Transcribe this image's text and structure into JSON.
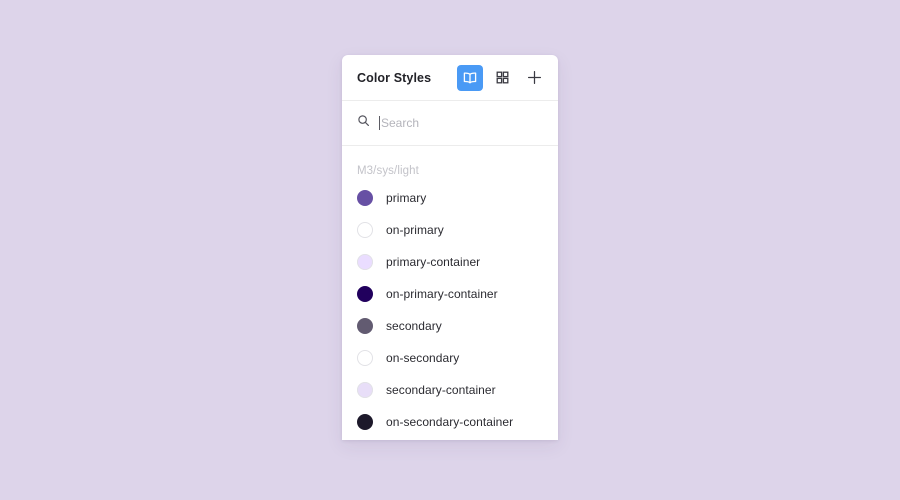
{
  "background_color": "#ddd4ea",
  "panel": {
    "header": {
      "title": "Color Styles",
      "actions": [
        {
          "icon": "book-icon",
          "name": "list-view-button",
          "active": true
        },
        {
          "icon": "grid-icon",
          "name": "grid-view-button",
          "active": false
        },
        {
          "icon": "plus-icon",
          "name": "add-style-button",
          "active": false
        }
      ],
      "accent_color": "#4a9af5"
    },
    "search": {
      "icon": "search-icon",
      "value": "",
      "placeholder": "Search",
      "focused": true
    },
    "list": {
      "group_label": "M3/sys/light",
      "items": [
        {
          "label": "primary",
          "color": "#6750a4",
          "light": false
        },
        {
          "label": "on-primary",
          "color": "#ffffff",
          "light": true
        },
        {
          "label": "primary-container",
          "color": "#eaddff",
          "light": true
        },
        {
          "label": "on-primary-container",
          "color": "#21005d",
          "light": false
        },
        {
          "label": "secondary",
          "color": "#625b71",
          "light": false
        },
        {
          "label": "on-secondary",
          "color": "#ffffff",
          "light": true
        },
        {
          "label": "secondary-container",
          "color": "#e8def8",
          "light": true
        },
        {
          "label": "on-secondary-container",
          "color": "#1d192b",
          "light": false
        }
      ]
    }
  }
}
